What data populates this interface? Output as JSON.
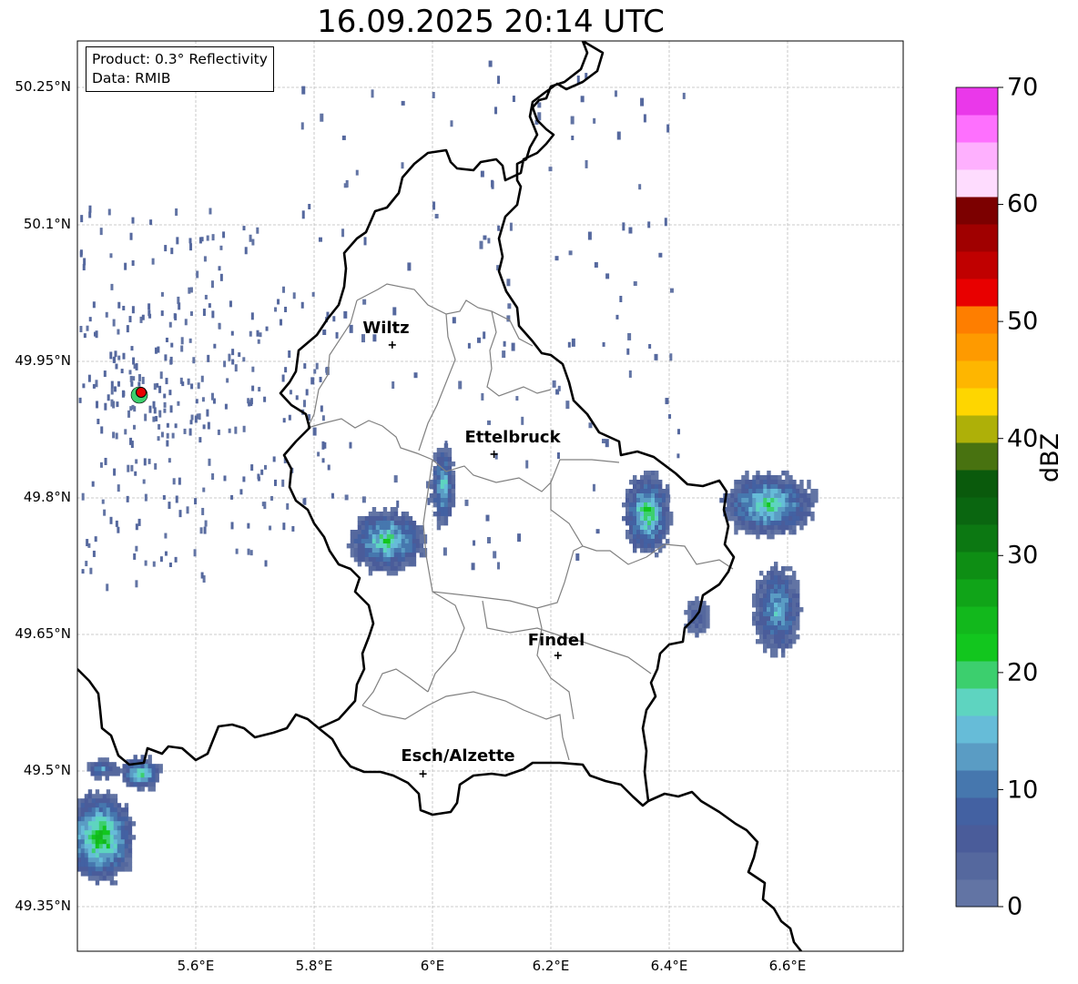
{
  "title": "16.09.2025 20:14 UTC",
  "info": {
    "product": "Product: 0.3° Reflectivity",
    "data": "Data: RMIB"
  },
  "axes": {
    "lat_labels": [
      "50.25°N",
      "50.1°N",
      "49.95°N",
      "49.8°N",
      "49.65°N",
      "49.5°N",
      "49.35°N"
    ],
    "lon_labels": [
      "5.6°E",
      "5.8°E",
      "6°E",
      "6.2°E",
      "6.4°E",
      "6.6°E"
    ],
    "grid": true
  },
  "cities": [
    {
      "name": "Wiltz",
      "lat": 49.968,
      "lon": 5.932
    },
    {
      "name": "Ettelbruck",
      "lat": 49.848,
      "lon": 6.104
    },
    {
      "name": "Findel",
      "lat": 49.627,
      "lon": 6.212
    },
    {
      "name": "Esch/Alzette",
      "lat": 49.497,
      "lon": 5.984
    }
  ],
  "radar_site": {
    "lat": 49.915,
    "lon": 5.505
  },
  "colorbar": {
    "label": "dBZ",
    "ticks": [
      "0",
      "10",
      "20",
      "30",
      "40",
      "50",
      "60",
      "70"
    ],
    "min": 0,
    "max": 70,
    "step": 2.5,
    "colors": [
      "#6274a4",
      "#55689e",
      "#4a5c9a",
      "#4361a2",
      "#4677ae",
      "#5a9cc4",
      "#66bcd8",
      "#5ed4c0",
      "#3ccf6e",
      "#12c61e",
      "#12b81c",
      "#10a418",
      "#0e8e14",
      "#0c7812",
      "#0a6610",
      "#0a5a0c",
      "#487210",
      "#aeb008",
      "#fed600",
      "#feb600",
      "#fe9a00",
      "#fe7e00",
      "#e80000",
      "#c00000",
      "#a00000",
      "#7c0000",
      "#fedcfe",
      "#feb0fe",
      "#fe70fe",
      "#ea38ea"
    ]
  },
  "echoes": [
    {
      "name": "cell-west-redange",
      "lat": 49.755,
      "lon": 5.92,
      "dlat": 0.035,
      "dlon": 0.065,
      "peak": 22
    },
    {
      "name": "cell-line-north",
      "lat": 49.815,
      "lon": 6.015,
      "dlat": 0.045,
      "dlon": 0.02,
      "peak": 20
    },
    {
      "name": "cell-east-1",
      "lat": 49.785,
      "lon": 6.36,
      "dlat": 0.045,
      "dlon": 0.04,
      "peak": 24
    },
    {
      "name": "cell-east-2",
      "lat": 49.795,
      "lon": 6.565,
      "dlat": 0.035,
      "dlon": 0.08,
      "peak": 22
    },
    {
      "name": "cell-east-3",
      "lat": 49.68,
      "lon": 6.58,
      "dlat": 0.05,
      "dlon": 0.04,
      "peak": 17
    },
    {
      "name": "cell-east-4",
      "lat": 49.672,
      "lon": 6.445,
      "dlat": 0.02,
      "dlon": 0.02,
      "peak": 8
    },
    {
      "name": "cell-south-west-1",
      "lat": 49.43,
      "lon": 5.435,
      "dlat": 0.05,
      "dlon": 0.06,
      "peak": 28
    },
    {
      "name": "cell-south-west-2",
      "lat": 49.5,
      "lon": 5.505,
      "dlat": 0.018,
      "dlon": 0.035,
      "peak": 22
    },
    {
      "name": "cell-south-west-3",
      "lat": 49.505,
      "lon": 5.44,
      "dlat": 0.01,
      "dlon": 0.03,
      "peak": 14
    }
  ]
}
